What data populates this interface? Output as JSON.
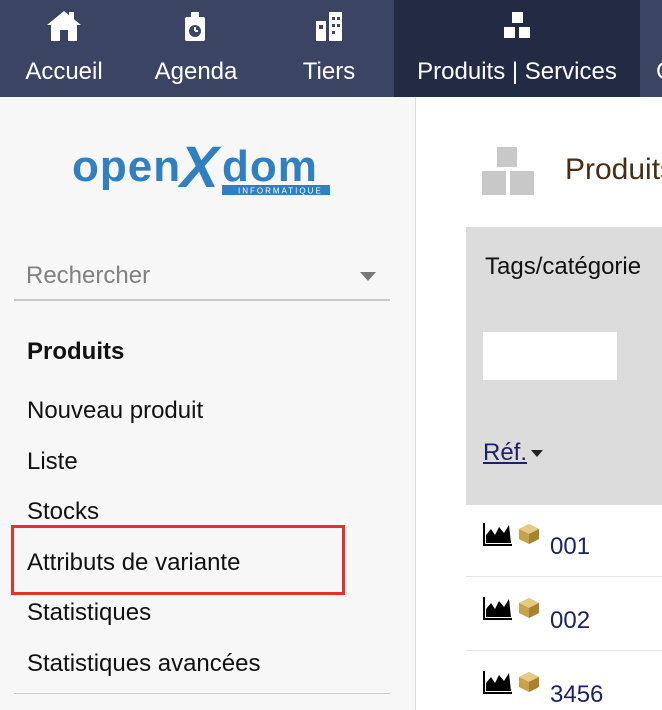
{
  "nav": {
    "items": [
      {
        "label": "Accueil",
        "icon": "home-icon"
      },
      {
        "label": "Agenda",
        "icon": "agenda-icon"
      },
      {
        "label": "Tiers",
        "icon": "buildings-icon"
      },
      {
        "label": "Produits | Services",
        "icon": "boxes-icon",
        "active": true
      },
      {
        "label": "C",
        "icon": "more-icon"
      }
    ]
  },
  "sidebar": {
    "logo_text": "openXdom",
    "logo_subtext": "INFORMATIQUE",
    "search_placeholder": "Rechercher",
    "menu_title": "Produits",
    "items": [
      {
        "label": "Nouveau produit"
      },
      {
        "label": "Liste"
      },
      {
        "label": "Stocks"
      },
      {
        "label": "Attributs de variante",
        "highlighted": true
      },
      {
        "label": "Statistiques"
      },
      {
        "label": "Statistiques avancées"
      }
    ]
  },
  "main": {
    "page_title": "Produits",
    "table": {
      "filter_label": "Tags/catégorie",
      "sort_label": "Réf.",
      "rows": [
        {
          "ref": "001"
        },
        {
          "ref": "002"
        },
        {
          "ref": "3456"
        }
      ]
    }
  },
  "colors": {
    "topbar": "#3b4462",
    "topbar_active": "#222b43",
    "highlight": "#e8312a",
    "link": "#1c2266",
    "title": "#4a2e14",
    "logo_blue": "#2f7fc1"
  }
}
